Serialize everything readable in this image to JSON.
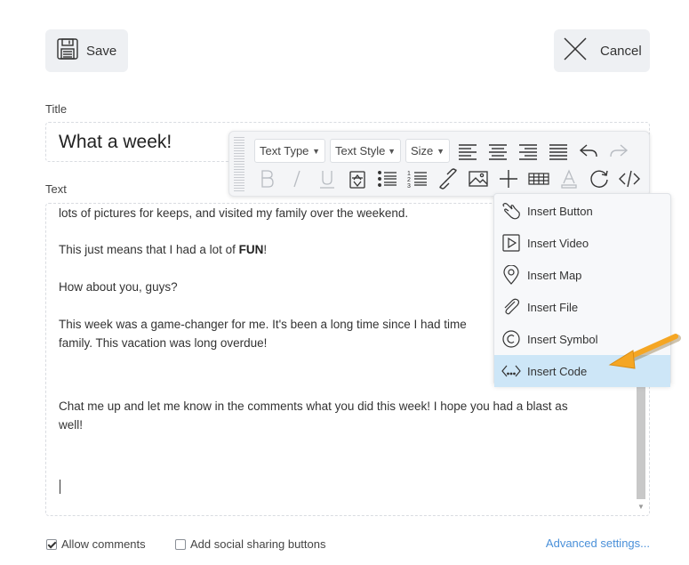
{
  "header": {
    "save_label": "Save",
    "cancel_label": "Cancel"
  },
  "title_field": {
    "label": "Title",
    "value": "What a week!"
  },
  "text_field": {
    "label": "Text",
    "paragraphs": [
      "lots of pictures for keeps, and visited my family over the weekend.",
      "This just means that I had a lot of ",
      "FUN",
      "!",
      "How about you, guys?",
      "This week was a game-changer for me. It's been a long time since I had time",
      "family. This vacation was long overdue!",
      "Chat me up and let me know in the comments what you did this week! I hope you had a blast as",
      "well!"
    ]
  },
  "toolbar": {
    "text_type": "Text Type",
    "text_style": "Text Style",
    "size": "Size",
    "icons": [
      "align-left-icon",
      "align-center-icon",
      "align-right-icon",
      "align-justify-icon",
      "undo-icon",
      "redo-icon",
      "bold-icon",
      "italic-icon",
      "underline-icon",
      "clear-format-icon",
      "bullet-list-icon",
      "numbered-list-icon",
      "link-icon",
      "image-icon",
      "plus-icon",
      "table-icon",
      "font-color-icon",
      "refresh-icon",
      "code-icon"
    ]
  },
  "insert_menu": {
    "items": [
      {
        "label": "Insert Button",
        "icon": "hand-pointer-icon"
      },
      {
        "label": "Insert Video",
        "icon": "video-play-icon"
      },
      {
        "label": "Insert Map",
        "icon": "map-pin-icon"
      },
      {
        "label": "Insert File",
        "icon": "paperclip-icon"
      },
      {
        "label": "Insert Symbol",
        "icon": "copyright-symbol-icon"
      },
      {
        "label": "Insert Code",
        "icon": "code-brackets-icon"
      }
    ],
    "active_index": 5,
    "active_color": "#cde6f7"
  },
  "footer": {
    "allow_comments_label": "Allow comments",
    "allow_comments_checked": true,
    "social_sharing_label": "Add social sharing buttons",
    "social_sharing_checked": false,
    "advanced_settings_label": "Advanced settings..."
  },
  "colors": {
    "accent_link": "#4a90d9",
    "annotation_arrow": "#f5a623",
    "button_bg": "#eef0f3"
  }
}
